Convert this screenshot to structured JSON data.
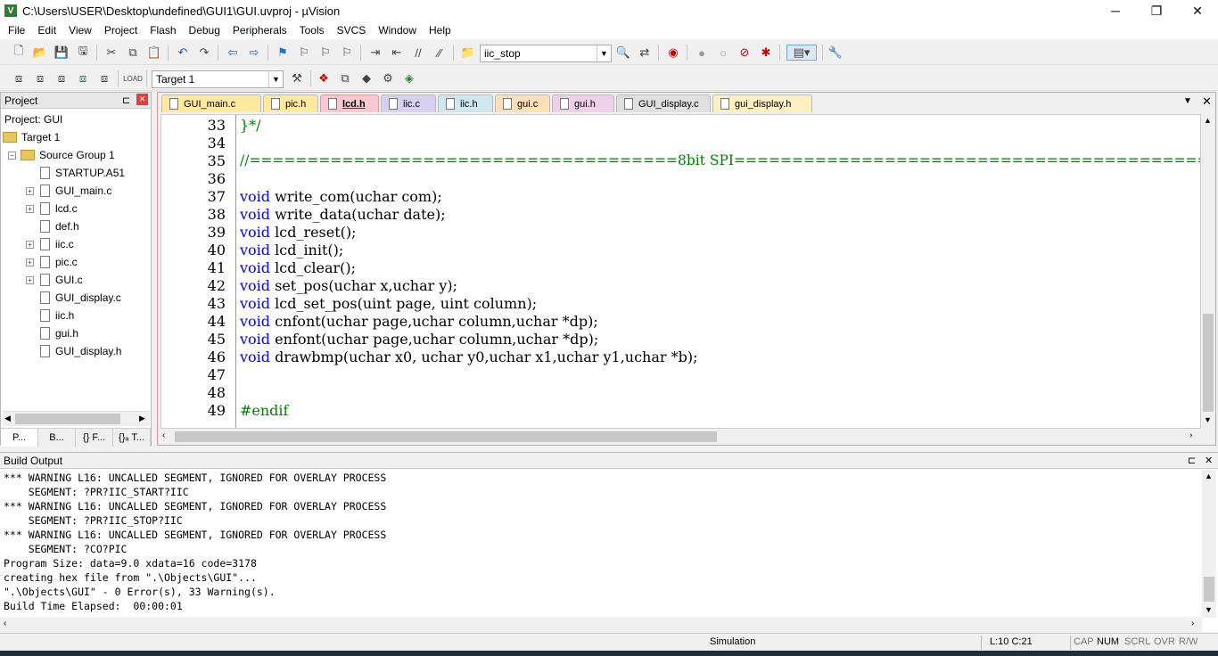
{
  "window": {
    "title": "C:\\Users\\USER\\Desktop\\undefined\\GUI1\\GUI.uvproj - µVision",
    "minimize": "─",
    "maximize": "❐",
    "close": "✕"
  },
  "menu": [
    "File",
    "Edit",
    "View",
    "Project",
    "Flash",
    "Debug",
    "Peripherals",
    "Tools",
    "SVCS",
    "Window",
    "Help"
  ],
  "toolbar1": {
    "find_value": "iic_stop"
  },
  "toolbar2": {
    "target_value": "Target 1"
  },
  "project_panel": {
    "title": "Project",
    "pin": "⊏",
    "close": "✕",
    "root": "Project: GUI",
    "target": "Target 1",
    "group": "Source Group 1",
    "files": [
      "STARTUP.A51",
      "GUI_main.c",
      "lcd.c",
      "def.h",
      "iic.c",
      "pic.c",
      "GUI.c",
      "GUI_display.c",
      "iic.h",
      "gui.h",
      "GUI_display.h"
    ],
    "tabs": [
      "P...",
      "B...",
      "{} F...",
      "{}ₐ T..."
    ]
  },
  "editor": {
    "tabs": [
      "GUI_main.c",
      "pic.h",
      "lcd.h",
      "iic.c",
      "iic.h",
      "gui.c",
      "gui.h",
      "GUI_display.c",
      "gui_display.h"
    ],
    "active_tab": "lcd.h",
    "lines": [
      {
        "num": "33",
        "text": "}*/",
        "type": "cm"
      },
      {
        "num": "34",
        "text": "",
        "type": "plain"
      },
      {
        "num": "35",
        "text": "//=====================================8bit SPI==========================================",
        "type": "cm"
      },
      {
        "num": "36",
        "text": "",
        "type": "plain"
      },
      {
        "num": "37",
        "kw": "void",
        "text": " write_com(uchar com);",
        "type": "decl"
      },
      {
        "num": "38",
        "kw": "void",
        "text": " write_data(uchar date);",
        "type": "decl"
      },
      {
        "num": "39",
        "kw": "void",
        "text": " lcd_reset();",
        "type": "decl"
      },
      {
        "num": "40",
        "kw": "void",
        "text": " lcd_init();",
        "type": "decl"
      },
      {
        "num": "41",
        "kw": "void",
        "text": " lcd_clear();",
        "type": "decl"
      },
      {
        "num": "42",
        "kw": "void",
        "text": " set_pos(uchar x,uchar y);",
        "type": "decl"
      },
      {
        "num": "43",
        "kw": "void",
        "text": " lcd_set_pos(uint page, uint column);",
        "type": "decl"
      },
      {
        "num": "44",
        "kw": "void",
        "text": " cnfont(uchar page,uchar column,uchar *dp);",
        "type": "decl"
      },
      {
        "num": "45",
        "kw": "void",
        "text": " enfont(uchar page,uchar column,uchar *dp);",
        "type": "decl"
      },
      {
        "num": "46",
        "kw": "void",
        "text": " drawbmp(uchar x0, uchar y0,uchar x1,uchar y1,uchar *b);",
        "type": "decl"
      },
      {
        "num": "47",
        "text": "",
        "type": "plain"
      },
      {
        "num": "48",
        "text": "",
        "type": "plain"
      },
      {
        "num": "49",
        "text": "#endif",
        "type": "pp"
      }
    ]
  },
  "build_output": {
    "title": "Build Output",
    "pin": "⊏",
    "close": "✕",
    "lines": [
      "*** WARNING L16: UNCALLED SEGMENT, IGNORED FOR OVERLAY PROCESS",
      "    SEGMENT: ?PR?IIC_START?IIC",
      "*** WARNING L16: UNCALLED SEGMENT, IGNORED FOR OVERLAY PROCESS",
      "    SEGMENT: ?PR?IIC_STOP?IIC",
      "*** WARNING L16: UNCALLED SEGMENT, IGNORED FOR OVERLAY PROCESS",
      "    SEGMENT: ?CO?PIC",
      "Program Size: data=9.0 xdata=16 code=3178",
      "creating hex file from \".\\Objects\\GUI\"...",
      "\".\\Objects\\GUI\" - 0 Error(s), 33 Warning(s).",
      "Build Time Elapsed:  00:00:01"
    ]
  },
  "status": {
    "mode": "Simulation",
    "position": "L:10 C:21",
    "cap": "CAP",
    "num": "NUM",
    "scrl": "SCRL",
    "ovr": "OVR",
    "rw": "R/W"
  },
  "colors": {
    "keyword": "#0000ff",
    "comment": "#008000",
    "tab_colors": [
      "#fde9a0",
      "#fde9a0",
      "#f7c8cf",
      "#d8d0f0",
      "#cfe8f0",
      "#fde0b8",
      "#f0d0e8",
      "#e0e0e0",
      "#fdf0c0"
    ]
  }
}
